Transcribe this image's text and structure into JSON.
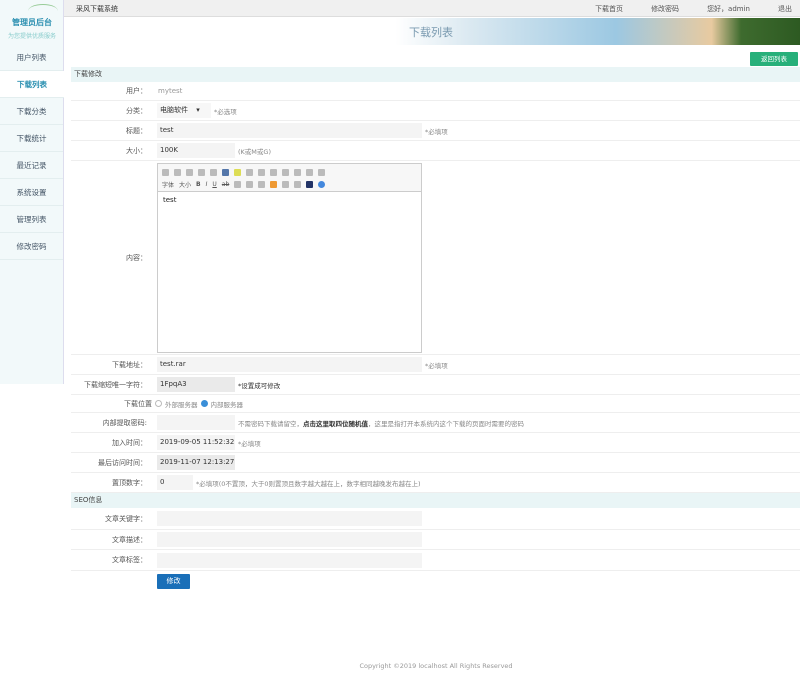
{
  "sidebar": {
    "title": "管理员后台",
    "subtitle": "为您提供优质服务",
    "items": [
      {
        "label": "用户列表"
      },
      {
        "label": "下载列表"
      },
      {
        "label": "下载分类"
      },
      {
        "label": "下载统计"
      },
      {
        "label": "最近记录"
      },
      {
        "label": "系统设置"
      },
      {
        "label": "管理列表"
      },
      {
        "label": "修改密码"
      }
    ]
  },
  "topbar": {
    "system": "采风下载系统",
    "links": [
      "下载首页",
      "修改密码",
      "您好，admin",
      "退出"
    ]
  },
  "banner": {
    "title": "下载列表"
  },
  "back_button": "返回列表",
  "section1": "下载修改",
  "form": {
    "user": {
      "label": "用户：",
      "value": "mytest"
    },
    "category": {
      "label": "分类：",
      "value": "电脑软件",
      "hint": "*必选项"
    },
    "title": {
      "label": "标题：",
      "value": "test",
      "hint": "*必填项"
    },
    "size": {
      "label": "大小：",
      "value": "100K",
      "hint": "(K或M或G)"
    },
    "content": {
      "label": "内容：",
      "value": "test",
      "toolbar_font": "字体",
      "toolbar_size": "大小"
    },
    "url": {
      "label": "下载地址：",
      "value": "test.rar",
      "hint": "*必填项"
    },
    "code": {
      "label": "下载缩短唯一字符：",
      "value": "1FpqA3",
      "hint": "*设置成可修改"
    },
    "location": {
      "label": "下载位置",
      "options": [
        "外部服务器",
        "内部服务器"
      ],
      "selected": 1
    },
    "extract": {
      "label": "内部提取密码:",
      "value": "",
      "hint_pre": "不需密码下载请留空，",
      "hint_link": "点击这里取四位随机值",
      "hint_post": "，这里是指打开本系统内这个下载的页面时需要的密码"
    },
    "added": {
      "label": "加入时间：",
      "value": "2019-09-05 11:52:32",
      "hint": "*必填项"
    },
    "visited": {
      "label": "最后访问时间：",
      "value": "2019-11-07 12:13:27"
    },
    "top": {
      "label": "置顶数字：",
      "value": "0",
      "hint": "*必填项(0不置顶，大于0则置顶且数字越大越在上，数字相同越晚发布越在上)"
    }
  },
  "section2": "SEO信息",
  "seo": {
    "keywords": {
      "label": "文章关键字："
    },
    "description": {
      "label": "文章描述："
    },
    "tags": {
      "label": "文章标签："
    }
  },
  "submit": "修改",
  "footer": "Copyright ©2019 localhost All Rights Reserved"
}
